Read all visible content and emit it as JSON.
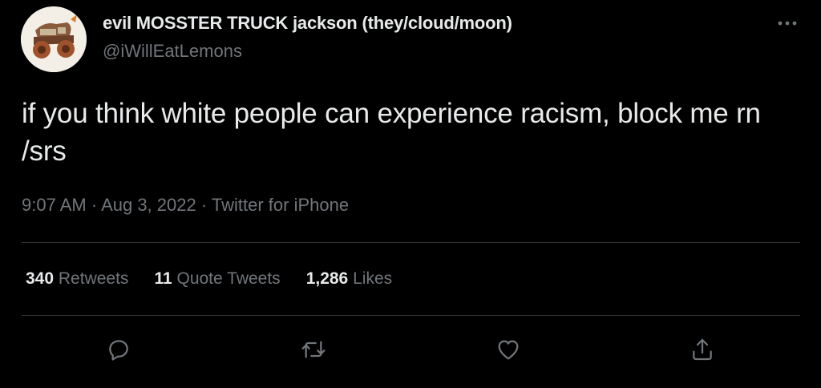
{
  "tweet": {
    "author": {
      "display_name": "evil MOSSTER TRUCK jackson (they/cloud/moon)",
      "handle": "@iWillEatLemons",
      "avatar_icon": "monster-truck-drawing"
    },
    "text": "if you think white people can experience racism, block me rn /srs",
    "time": "9:07 AM",
    "date": "Aug 3, 2022",
    "source": "Twitter for iPhone",
    "separator": " · "
  },
  "stats": {
    "retweets": {
      "count": "340",
      "label": "Retweets"
    },
    "quote_tweets": {
      "count": "11",
      "label": "Quote Tweets"
    },
    "likes": {
      "count": "1,286",
      "label": "Likes"
    }
  },
  "actions": [
    "reply-icon",
    "retweet-icon",
    "like-icon",
    "share-icon"
  ],
  "colors": {
    "background": "#000000",
    "primary_text": "#e7e9ea",
    "secondary_text": "#71767b",
    "divider": "#2f3336"
  }
}
